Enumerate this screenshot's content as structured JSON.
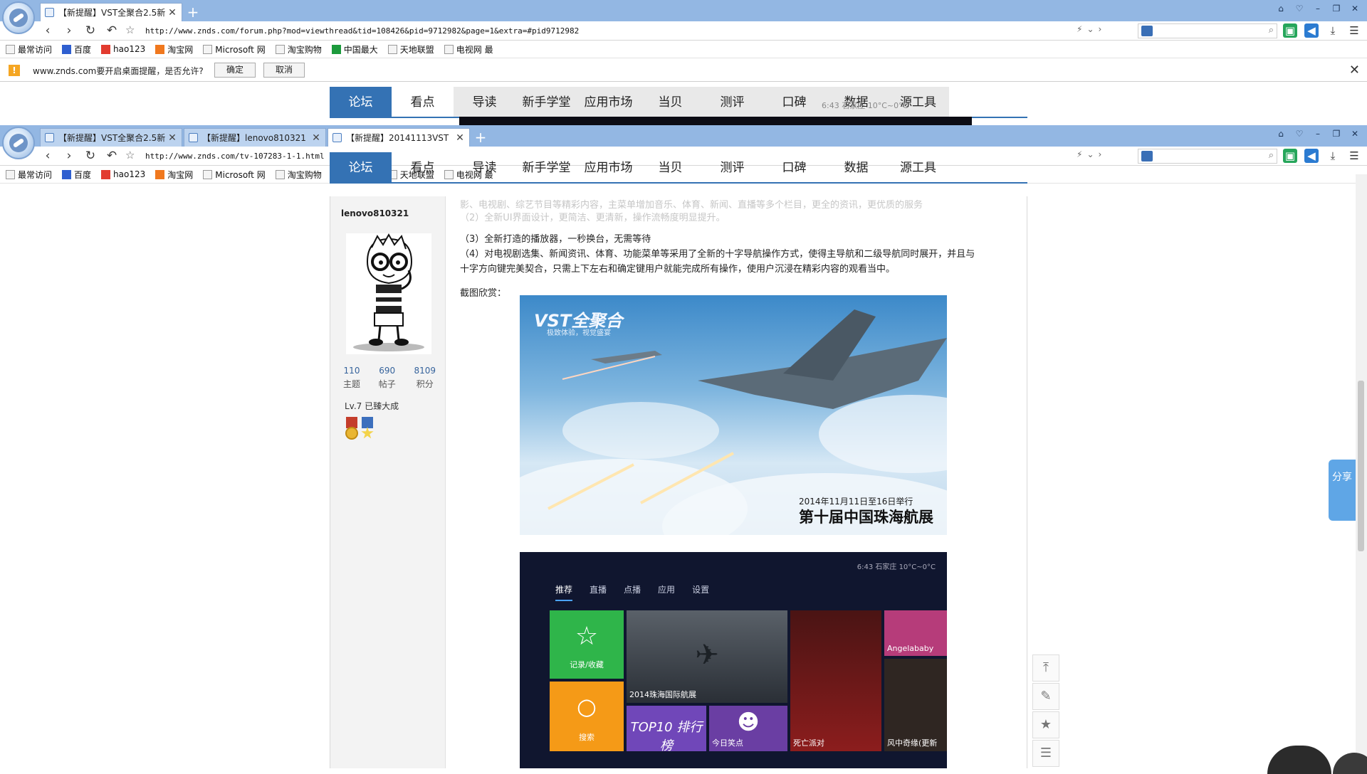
{
  "win1": {
    "tabs": [
      {
        "title": "【新提醒】VST全聚合2.5新",
        "active": true
      }
    ],
    "new_tab": "+",
    "window_controls": [
      "⌂",
      "♡",
      "–",
      "❐",
      "✕"
    ],
    "url": "http://www.znds.com/forum.php?mod=viewthread&tid=108426&pid=9712982&page=1&extra=#pid9712982",
    "bookmarks": [
      "最常访问",
      "百度",
      "hao123",
      "淘宝网",
      "Microsoft 网",
      "淘宝购物",
      "中国最大",
      "天地联盟",
      "电视网 最"
    ],
    "notification": {
      "message": "www.znds.com要开启桌面提醒，是否允许?",
      "ok": "确定",
      "cancel": "取消",
      "close": "✕"
    },
    "peek_status": "6:43  石家庄  10°C~0°C"
  },
  "win2": {
    "tabs": [
      {
        "title": "【新提醒】VST全聚合2.5新",
        "active": false
      },
      {
        "title": "【新提醒】lenovo810321",
        "active": false
      },
      {
        "title": "【新提醒】20141113VST",
        "active": true
      }
    ],
    "new_tab": "+",
    "url": "http://www.znds.com/tv-107283-1-1.html"
  },
  "site_nav": [
    "论坛",
    "看点",
    "导读",
    "新手学堂",
    "应用市场",
    "当贝",
    "测评",
    "口碑",
    "数据",
    "源工具"
  ],
  "user": {
    "name": "lenovo810321",
    "stats": [
      {
        "value": "110",
        "label": "主题"
      },
      {
        "value": "690",
        "label": "帖子"
      },
      {
        "value": "8109",
        "label": "积分"
      }
    ],
    "level": "Lv.7 已臻大成"
  },
  "post": {
    "faded_lines": [
      "影、电视剧、综艺节目等精彩内容，主菜单增加音乐、体育、新闻、直播等多个栏目，更全的资讯，更优质的服务",
      "（2）全新UI界面设计，更简洁、更清新，操作流畅度明显提升。"
    ],
    "line3": "（3）全新打造的播放器，一秒换台，无需等待",
    "line4a": "（4）对电视剧选集、新闻资讯、体育、功能菜单等采用了全新的十字导航操作方式，使得主导航和二级导航同时展开，并且与",
    "line4b": "十字方向键完美契合，只需上下左右和确定键用户就能完成所有操作，使用户沉浸在精彩内容的观看当中。",
    "screenshots_label": "截图欣赏："
  },
  "shot1": {
    "brand": "VST全聚合",
    "brand_sub": "极致体验，视觉盛宴",
    "caption_date": "2014年11月11日至16日举行",
    "caption_title": "第十届中国珠海航展"
  },
  "shot2": {
    "status": "6:43  石家庄  10°C~0°C",
    "tabs": [
      "推荐",
      "直播",
      "点播",
      "应用",
      "设置"
    ],
    "tiles": {
      "favorites": "记录/收藏",
      "search": "搜索",
      "airshow": "2014珠海国际航展",
      "top10": "TOP10 排行榜",
      "funny": "今日笑点",
      "party": "死亡派对",
      "angela": "Angelababy",
      "drama": "风中奇缘(更新"
    }
  },
  "share": "分享",
  "side_tools": [
    "⤒",
    "✎",
    "★",
    "☰"
  ]
}
